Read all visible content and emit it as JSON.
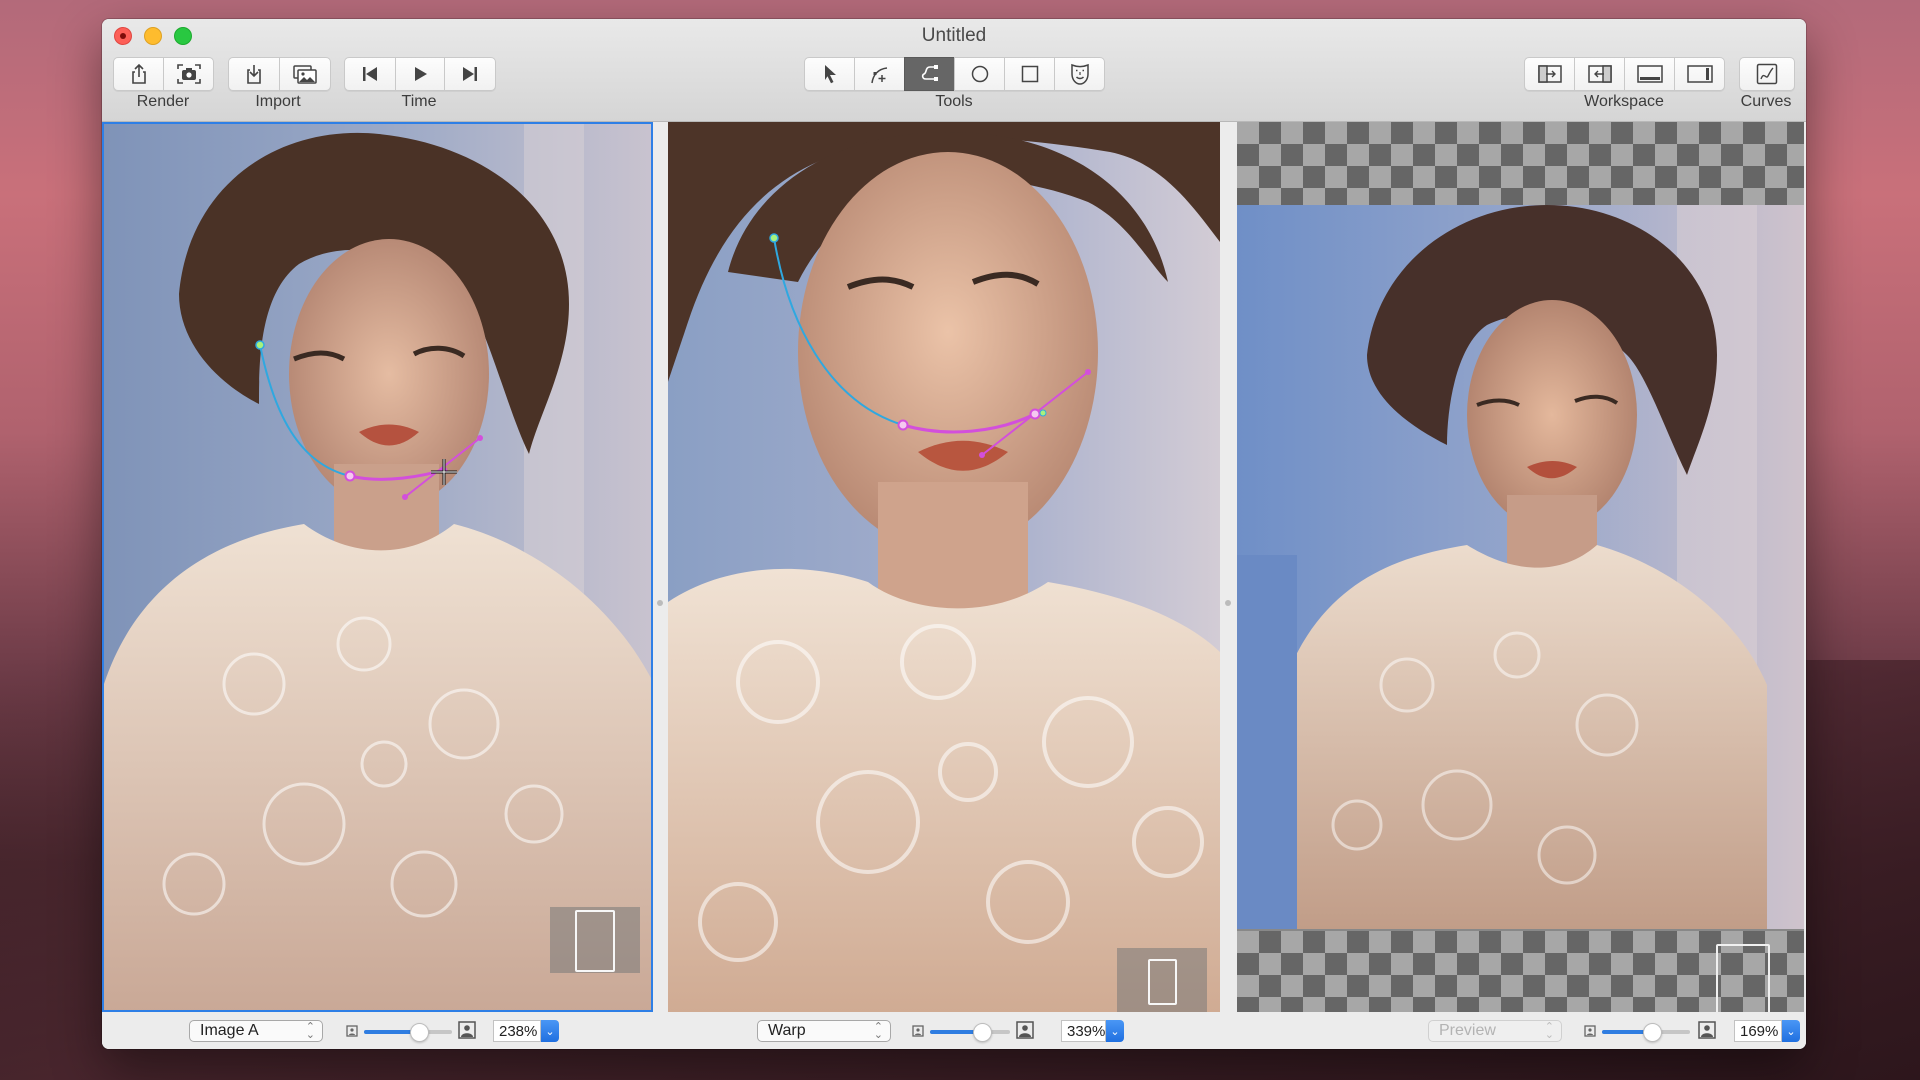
{
  "window": {
    "title": "Untitled"
  },
  "toolbar": {
    "groups": [
      {
        "label": "Render",
        "buttons": [
          {
            "icon": "share-icon",
            "name": "render-export"
          },
          {
            "icon": "screenshot-camera-icon",
            "name": "render-snapshot"
          }
        ]
      },
      {
        "label": "Import",
        "buttons": [
          {
            "icon": "import-icon",
            "name": "import-file"
          },
          {
            "icon": "photos-icon",
            "name": "import-photos"
          }
        ]
      },
      {
        "label": "Time",
        "buttons": [
          {
            "icon": "skip-back-icon",
            "name": "time-start"
          },
          {
            "icon": "play-icon",
            "name": "time-play"
          },
          {
            "icon": "skip-forward-icon",
            "name": "time-end"
          }
        ]
      },
      {
        "label": "Tools",
        "buttons": [
          {
            "icon": "pointer-arrow-icon",
            "name": "tool-select"
          },
          {
            "icon": "add-curve-point-icon",
            "name": "tool-add-point"
          },
          {
            "icon": "bezier-curve-icon",
            "name": "tool-curve",
            "active": true
          },
          {
            "icon": "circle-icon",
            "name": "tool-ellipse"
          },
          {
            "icon": "square-icon",
            "name": "tool-rectangle"
          },
          {
            "icon": "face-mask-icon",
            "name": "tool-face"
          }
        ]
      },
      {
        "label": "Workspace",
        "buttons": [
          {
            "icon": "panel-import-right-icon",
            "name": "workspace-left"
          },
          {
            "icon": "panel-import-left-icon",
            "name": "workspace-right"
          },
          {
            "icon": "bottom-panel-icon",
            "name": "workspace-bottom"
          },
          {
            "icon": "right-sidebar-icon",
            "name": "workspace-sidebar"
          }
        ]
      },
      {
        "label": "Curves",
        "buttons": [
          {
            "icon": "curves-graph-icon",
            "name": "curves"
          }
        ]
      }
    ]
  },
  "panels": [
    {
      "name": "image-a",
      "mode": "Image A",
      "zoom": "238%",
      "slider_fraction": 0.62,
      "selected": true,
      "mode_enabled": true
    },
    {
      "name": "warp",
      "mode": "Warp",
      "zoom": "339%",
      "slider_fraction": 0.65,
      "selected": false,
      "mode_enabled": true
    },
    {
      "name": "preview",
      "mode": "Preview",
      "zoom": "169%",
      "slider_fraction": 0.57,
      "selected": false,
      "mode_enabled": false
    }
  ],
  "colors": {
    "accent": "#2e7fe6",
    "curve_blue": "#2fa8e0",
    "curve_pink": "#d34fdc",
    "point_green": "#9ff07a"
  }
}
